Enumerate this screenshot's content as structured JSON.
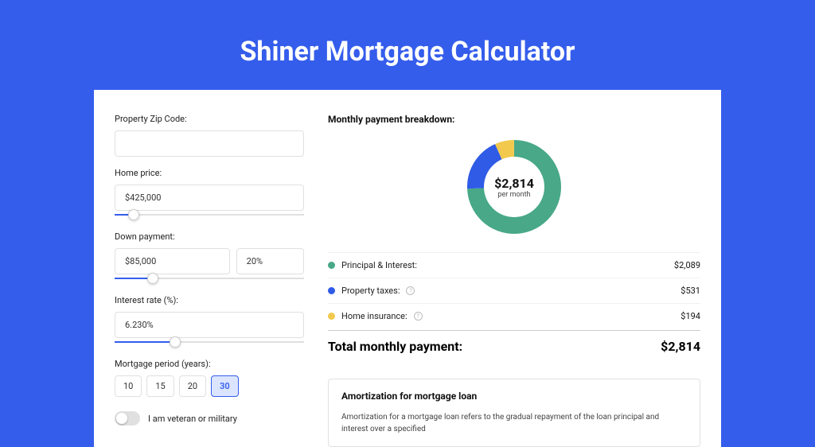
{
  "title": "Shiner Mortgage Calculator",
  "colors": {
    "green": "#48a888",
    "blue": "#2f5be6",
    "yellow": "#f2c94c"
  },
  "form": {
    "zip": {
      "label": "Property Zip Code:",
      "value": ""
    },
    "home_price": {
      "label": "Home price:",
      "value": "$425,000",
      "slider_pct": 10
    },
    "down_payment": {
      "label": "Down payment:",
      "amount": "$85,000",
      "percent": "20%",
      "slider_pct": 20
    },
    "interest": {
      "label": "Interest rate (%):",
      "value": "6.230%",
      "slider_pct": 32
    },
    "period": {
      "label": "Mortgage period (years):",
      "options": [
        "10",
        "15",
        "20",
        "30"
      ],
      "selected": "30"
    },
    "veteran": {
      "label": "I am veteran or military",
      "checked": false
    }
  },
  "breakdown": {
    "title": "Monthly payment breakdown:",
    "center": {
      "amount": "$2,814",
      "sub": "per month"
    },
    "rows": [
      {
        "color": "green",
        "label": "Principal & Interest:",
        "value": "$2,089",
        "info": false
      },
      {
        "color": "blue",
        "label": "Property taxes:",
        "value": "$531",
        "info": true
      },
      {
        "color": "yellow",
        "label": "Home insurance:",
        "value": "$194",
        "info": true
      }
    ],
    "total": {
      "label": "Total monthly payment:",
      "value": "$2,814"
    }
  },
  "amortization": {
    "title": "Amortization for mortgage loan",
    "text": "Amortization for a mortgage loan refers to the gradual repayment of the loan principal and interest over a specified"
  },
  "chart_data": {
    "type": "pie",
    "title": "Monthly payment breakdown",
    "categories": [
      "Principal & Interest",
      "Property taxes",
      "Home insurance"
    ],
    "values": [
      2089,
      531,
      194
    ],
    "colors": [
      "#48a888",
      "#2f5be6",
      "#f2c94c"
    ],
    "center_label": "$2,814 per month"
  }
}
